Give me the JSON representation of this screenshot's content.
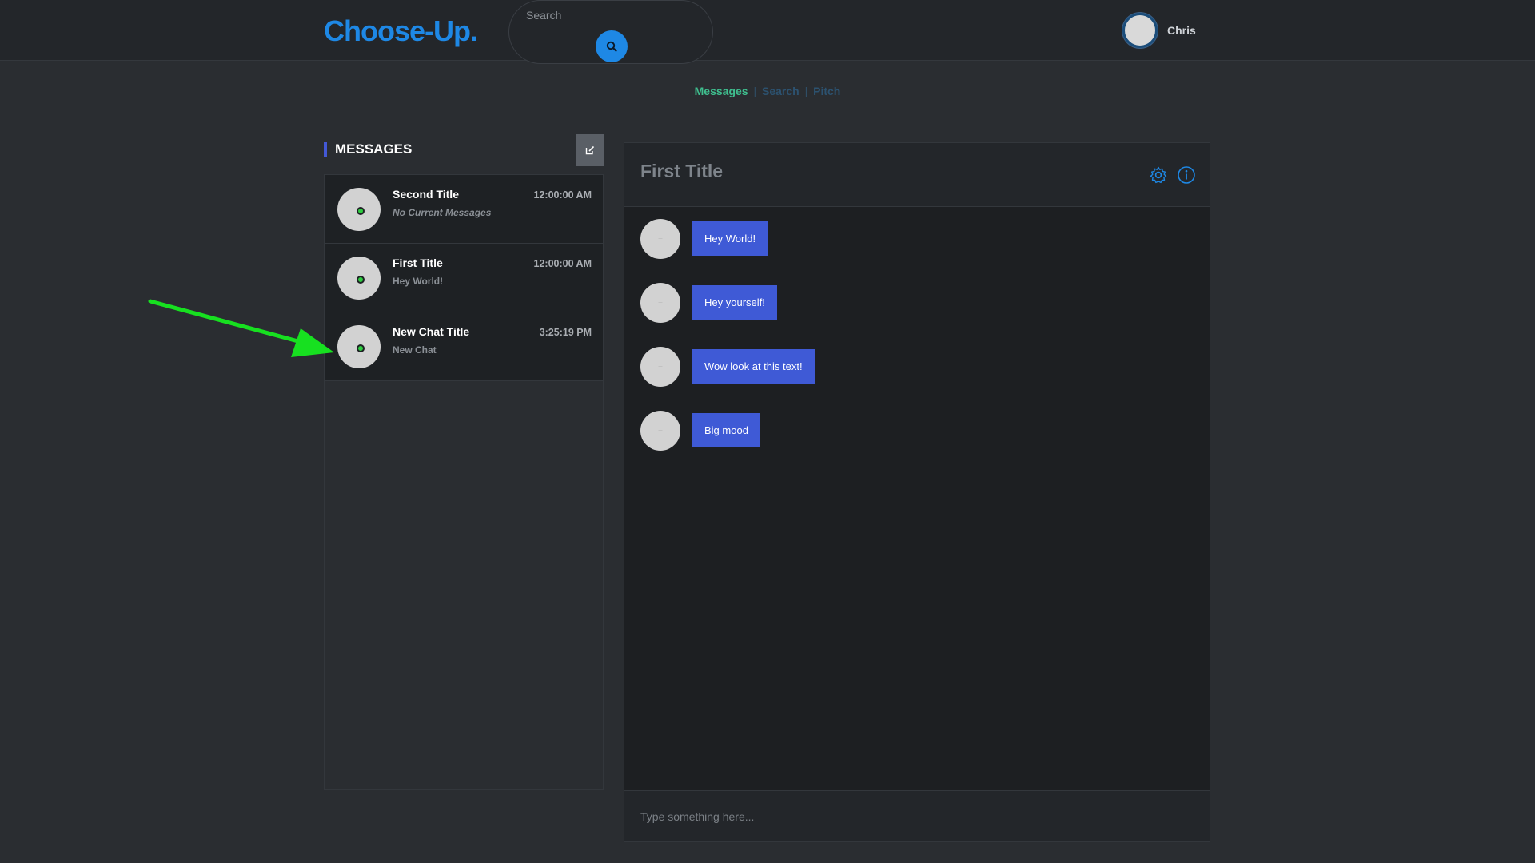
{
  "header": {
    "logo": "Choose-Up.",
    "search_placeholder": "Search",
    "search_icon": "search-icon",
    "user_name": "Chris"
  },
  "nav": {
    "tabs": [
      {
        "label": "Messages",
        "active": true
      },
      {
        "label": "Search",
        "active": false
      },
      {
        "label": "Pitch",
        "active": false
      }
    ],
    "separator": "|"
  },
  "messages": {
    "heading": "MESSAGES",
    "compose_icon": "edit-icon",
    "chats": [
      {
        "title": "Second Title",
        "preview": "No Current Messages",
        "time": "12:00:00 AM",
        "online": true
      },
      {
        "title": "First Title",
        "preview": "Hey World!",
        "time": "12:00:00 AM",
        "online": true
      },
      {
        "title": "New Chat Title",
        "preview": "New Chat",
        "time": "3:25:19 PM",
        "online": true
      }
    ]
  },
  "conversation": {
    "title": "First Title",
    "icons": [
      "gear-icon",
      "info-icon"
    ],
    "messages": [
      {
        "text": "Hey World!"
      },
      {
        "text": "Hey yourself!"
      },
      {
        "text": "Wow look at this text!"
      },
      {
        "text": "Big mood"
      }
    ],
    "input_placeholder": "Type something here..."
  },
  "colors": {
    "brand": "#1e88e5",
    "active_tab": "#3fbf8f",
    "bubble": "#3f5ad6",
    "online": "#2ecc40",
    "annotation_arrow": "#17e020"
  }
}
